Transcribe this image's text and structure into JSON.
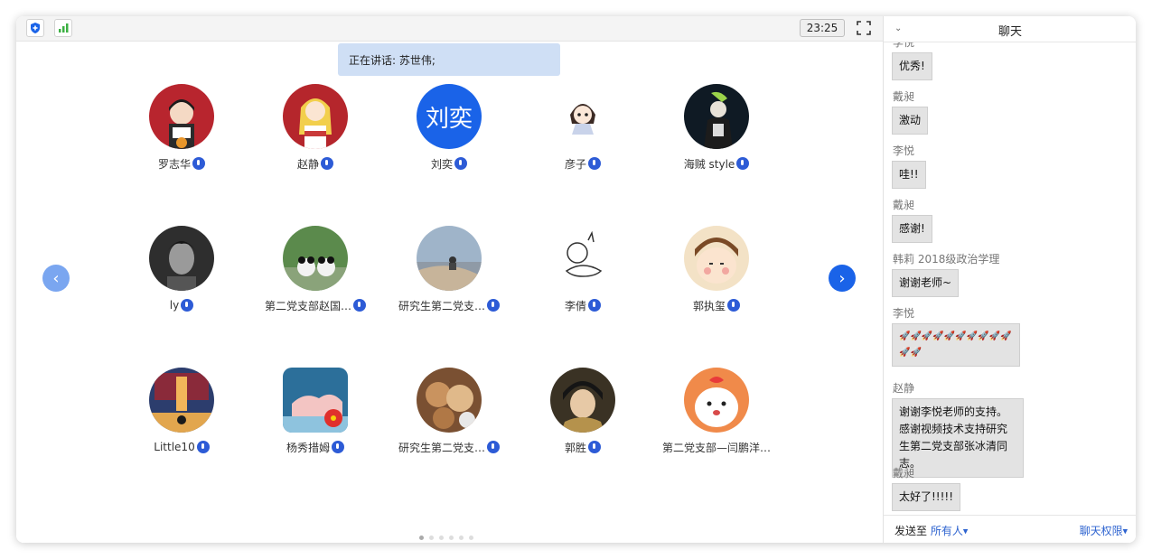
{
  "topbar": {
    "time": "23:25",
    "shield_icon": "shield-icon",
    "signal_icon": "signal-bars-icon",
    "fullscreen_icon": "fullscreen-icon"
  },
  "speaking": {
    "text": "正在讲话: 苏世伟;"
  },
  "avatar_text": {
    "liuyi": "刘奕"
  },
  "participants": [
    {
      "name": "罗志华"
    },
    {
      "name": "赵静"
    },
    {
      "name": "刘奕"
    },
    {
      "name": "彦子"
    },
    {
      "name": "海贼 style"
    },
    {
      "name": "ly"
    },
    {
      "name": "第二党支部赵国…"
    },
    {
      "name": "研究生第二党支…"
    },
    {
      "name": "李倩"
    },
    {
      "name": "郭执玺"
    },
    {
      "name": "Little10"
    },
    {
      "name": "杨秀措姆"
    },
    {
      "name": "研究生第二党支…"
    },
    {
      "name": "郭胜"
    },
    {
      "name": "第二党支部—闫鹏洋…"
    }
  ],
  "navigation": {
    "prev_icon": "chevron-left-icon",
    "next_icon": "chevron-right-icon",
    "pages": 6,
    "active_page": 1
  },
  "chat": {
    "title": "聊天",
    "collapse_icon": "chevron-down-icon",
    "messages": [
      {
        "sender": "李悦",
        "text": "优秀!"
      },
      {
        "sender": "戴昶",
        "text": "激动"
      },
      {
        "sender": "李悦",
        "text": "哇!!"
      },
      {
        "sender": "戴昶",
        "text": "感谢!"
      },
      {
        "sender": "韩莉 2018级政治学理",
        "text": "谢谢老师~"
      },
      {
        "sender": "李悦",
        "text": "🚀🚀🚀🚀🚀🚀🚀🚀🚀🚀🚀🚀"
      },
      {
        "sender": "赵静",
        "text": "谢谢李悦老师的支持。感谢视频技术支持研究生第二党支部张冰清同志。"
      },
      {
        "sender": "戴昶",
        "text": "太好了!!!!!"
      }
    ],
    "send_to_label": "发送至",
    "send_to_value": "所有人",
    "permission_label": "聊天权限"
  },
  "colors": {
    "accent": "#1a63e8",
    "speaking_bg": "#cfdff5",
    "prev_nav": "#7aa6f0"
  }
}
